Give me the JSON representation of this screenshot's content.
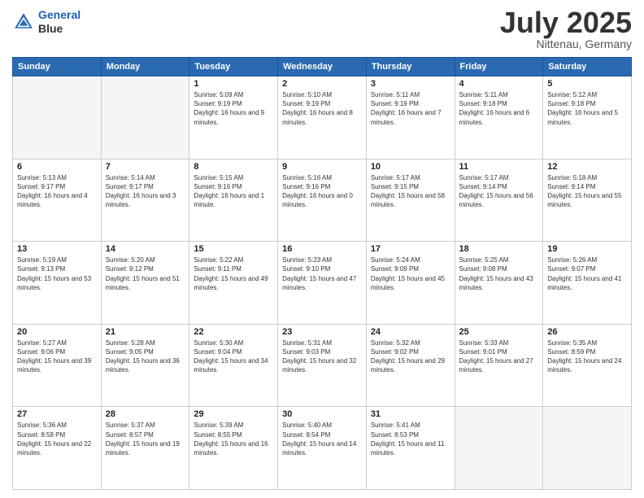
{
  "header": {
    "logo_line1": "General",
    "logo_line2": "Blue",
    "month": "July 2025",
    "location": "Nittenau, Germany"
  },
  "weekdays": [
    "Sunday",
    "Monday",
    "Tuesday",
    "Wednesday",
    "Thursday",
    "Friday",
    "Saturday"
  ],
  "weeks": [
    [
      {
        "day": "",
        "info": ""
      },
      {
        "day": "",
        "info": ""
      },
      {
        "day": "1",
        "info": "Sunrise: 5:09 AM\nSunset: 9:19 PM\nDaylight: 16 hours and 9 minutes."
      },
      {
        "day": "2",
        "info": "Sunrise: 5:10 AM\nSunset: 9:19 PM\nDaylight: 16 hours and 8 minutes."
      },
      {
        "day": "3",
        "info": "Sunrise: 5:11 AM\nSunset: 9:19 PM\nDaylight: 16 hours and 7 minutes."
      },
      {
        "day": "4",
        "info": "Sunrise: 5:11 AM\nSunset: 9:18 PM\nDaylight: 16 hours and 6 minutes."
      },
      {
        "day": "5",
        "info": "Sunrise: 5:12 AM\nSunset: 9:18 PM\nDaylight: 16 hours and 5 minutes."
      }
    ],
    [
      {
        "day": "6",
        "info": "Sunrise: 5:13 AM\nSunset: 9:17 PM\nDaylight: 16 hours and 4 minutes."
      },
      {
        "day": "7",
        "info": "Sunrise: 5:14 AM\nSunset: 9:17 PM\nDaylight: 16 hours and 3 minutes."
      },
      {
        "day": "8",
        "info": "Sunrise: 5:15 AM\nSunset: 9:16 PM\nDaylight: 16 hours and 1 minute."
      },
      {
        "day": "9",
        "info": "Sunrise: 5:16 AM\nSunset: 9:16 PM\nDaylight: 16 hours and 0 minutes."
      },
      {
        "day": "10",
        "info": "Sunrise: 5:17 AM\nSunset: 9:15 PM\nDaylight: 15 hours and 58 minutes."
      },
      {
        "day": "11",
        "info": "Sunrise: 5:17 AM\nSunset: 9:14 PM\nDaylight: 15 hours and 56 minutes."
      },
      {
        "day": "12",
        "info": "Sunrise: 5:18 AM\nSunset: 9:14 PM\nDaylight: 15 hours and 55 minutes."
      }
    ],
    [
      {
        "day": "13",
        "info": "Sunrise: 5:19 AM\nSunset: 9:13 PM\nDaylight: 15 hours and 53 minutes."
      },
      {
        "day": "14",
        "info": "Sunrise: 5:20 AM\nSunset: 9:12 PM\nDaylight: 15 hours and 51 minutes."
      },
      {
        "day": "15",
        "info": "Sunrise: 5:22 AM\nSunset: 9:11 PM\nDaylight: 15 hours and 49 minutes."
      },
      {
        "day": "16",
        "info": "Sunrise: 5:23 AM\nSunset: 9:10 PM\nDaylight: 15 hours and 47 minutes."
      },
      {
        "day": "17",
        "info": "Sunrise: 5:24 AM\nSunset: 9:09 PM\nDaylight: 15 hours and 45 minutes."
      },
      {
        "day": "18",
        "info": "Sunrise: 5:25 AM\nSunset: 9:08 PM\nDaylight: 15 hours and 43 minutes."
      },
      {
        "day": "19",
        "info": "Sunrise: 5:26 AM\nSunset: 9:07 PM\nDaylight: 15 hours and 41 minutes."
      }
    ],
    [
      {
        "day": "20",
        "info": "Sunrise: 5:27 AM\nSunset: 9:06 PM\nDaylight: 15 hours and 39 minutes."
      },
      {
        "day": "21",
        "info": "Sunrise: 5:28 AM\nSunset: 9:05 PM\nDaylight: 15 hours and 36 minutes."
      },
      {
        "day": "22",
        "info": "Sunrise: 5:30 AM\nSunset: 9:04 PM\nDaylight: 15 hours and 34 minutes."
      },
      {
        "day": "23",
        "info": "Sunrise: 5:31 AM\nSunset: 9:03 PM\nDaylight: 15 hours and 32 minutes."
      },
      {
        "day": "24",
        "info": "Sunrise: 5:32 AM\nSunset: 9:02 PM\nDaylight: 15 hours and 29 minutes."
      },
      {
        "day": "25",
        "info": "Sunrise: 5:33 AM\nSunset: 9:01 PM\nDaylight: 15 hours and 27 minutes."
      },
      {
        "day": "26",
        "info": "Sunrise: 5:35 AM\nSunset: 8:59 PM\nDaylight: 15 hours and 24 minutes."
      }
    ],
    [
      {
        "day": "27",
        "info": "Sunrise: 5:36 AM\nSunset: 8:58 PM\nDaylight: 15 hours and 22 minutes."
      },
      {
        "day": "28",
        "info": "Sunrise: 5:37 AM\nSunset: 8:57 PM\nDaylight: 15 hours and 19 minutes."
      },
      {
        "day": "29",
        "info": "Sunrise: 5:39 AM\nSunset: 8:55 PM\nDaylight: 15 hours and 16 minutes."
      },
      {
        "day": "30",
        "info": "Sunrise: 5:40 AM\nSunset: 8:54 PM\nDaylight: 15 hours and 14 minutes."
      },
      {
        "day": "31",
        "info": "Sunrise: 5:41 AM\nSunset: 8:53 PM\nDaylight: 15 hours and 11 minutes."
      },
      {
        "day": "",
        "info": ""
      },
      {
        "day": "",
        "info": ""
      }
    ]
  ]
}
